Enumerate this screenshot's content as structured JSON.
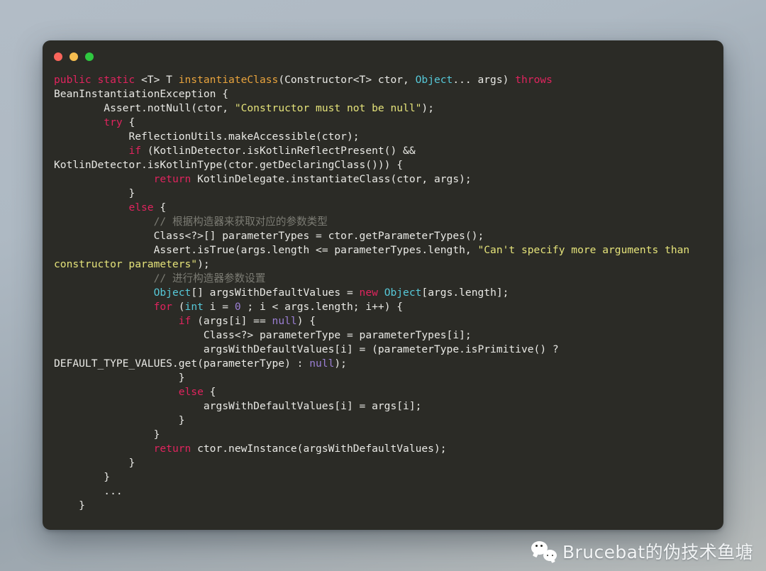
{
  "window": {
    "title": "",
    "controls": [
      {
        "name": "close",
        "color": "#f9655b"
      },
      {
        "name": "minimize",
        "color": "#f5bd4f"
      },
      {
        "name": "zoom",
        "color": "#2fc840"
      }
    ]
  },
  "theme": {
    "background_gradient_start": "#b2bcc6",
    "background_gradient_end": "#b8bcbb",
    "terminal_background": "#2b2b26",
    "plain_text": "#e9e9e5",
    "keyword": "#e0245e",
    "type": "#56c8d8",
    "function": "#e8a33d",
    "string": "#e5e37a",
    "comment": "#7c7c74",
    "number": "#9b7fd4"
  },
  "code": {
    "language": "java",
    "lines": [
      [
        {
          "t": "public static ",
          "c": "kw"
        },
        {
          "t": "<T> T ",
          "c": "pln"
        },
        {
          "t": "instantiateClass",
          "c": "fn"
        },
        {
          "t": "(Constructor<T> ctor, ",
          "c": "pln"
        },
        {
          "t": "Object",
          "c": "typ"
        },
        {
          "t": "... args) ",
          "c": "pln"
        },
        {
          "t": "throws",
          "c": "kw"
        }
      ],
      [
        {
          "t": "BeanInstantiationException {",
          "c": "pln"
        }
      ],
      [
        {
          "t": "        Assert.notNull(ctor, ",
          "c": "pln"
        },
        {
          "t": "\"Constructor must not be null\"",
          "c": "str"
        },
        {
          "t": ");",
          "c": "pln"
        }
      ],
      [
        {
          "t": "        ",
          "c": "pln"
        },
        {
          "t": "try",
          "c": "kw"
        },
        {
          "t": " {",
          "c": "pln"
        }
      ],
      [
        {
          "t": "            ReflectionUtils.makeAccessible(ctor);",
          "c": "pln"
        }
      ],
      [
        {
          "t": "            ",
          "c": "pln"
        },
        {
          "t": "if",
          "c": "kw"
        },
        {
          "t": " (KotlinDetector.isKotlinReflectPresent() &&",
          "c": "pln"
        }
      ],
      [
        {
          "t": "KotlinDetector.isKotlinType(ctor.getDeclaringClass())) {",
          "c": "pln"
        }
      ],
      [
        {
          "t": "                ",
          "c": "pln"
        },
        {
          "t": "return",
          "c": "kw"
        },
        {
          "t": " KotlinDelegate.instantiateClass(ctor, args);",
          "c": "pln"
        }
      ],
      [
        {
          "t": "            }",
          "c": "pln"
        }
      ],
      [
        {
          "t": "            ",
          "c": "pln"
        },
        {
          "t": "else",
          "c": "kw"
        },
        {
          "t": " {",
          "c": "pln"
        }
      ],
      [
        {
          "t": "                // 根据构造器来获取对应的参数类型",
          "c": "cmt"
        }
      ],
      [
        {
          "t": "                Class<?>[] parameterTypes = ctor.getParameterTypes();",
          "c": "pln"
        }
      ],
      [
        {
          "t": "                Assert.isTrue(args.length <= parameterTypes.length, ",
          "c": "pln"
        },
        {
          "t": "\"Can't specify more arguments than",
          "c": "str"
        }
      ],
      [
        {
          "t": "constructor parameters\"",
          "c": "str"
        },
        {
          "t": ");",
          "c": "pln"
        }
      ],
      [
        {
          "t": "                // 进行构造器参数设置",
          "c": "cmt"
        }
      ],
      [
        {
          "t": "                ",
          "c": "pln"
        },
        {
          "t": "Object",
          "c": "typ"
        },
        {
          "t": "[] argsWithDefaultValues = ",
          "c": "pln"
        },
        {
          "t": "new ",
          "c": "kw"
        },
        {
          "t": "Object",
          "c": "typ"
        },
        {
          "t": "[args.length];",
          "c": "pln"
        }
      ],
      [
        {
          "t": "                ",
          "c": "pln"
        },
        {
          "t": "for",
          "c": "kw"
        },
        {
          "t": " (",
          "c": "pln"
        },
        {
          "t": "int",
          "c": "typ"
        },
        {
          "t": " i = ",
          "c": "pln"
        },
        {
          "t": "0",
          "c": "num"
        },
        {
          "t": " ; i < args.length; i++) {",
          "c": "pln"
        }
      ],
      [
        {
          "t": "                    ",
          "c": "pln"
        },
        {
          "t": "if",
          "c": "kw"
        },
        {
          "t": " (args[i] == ",
          "c": "pln"
        },
        {
          "t": "null",
          "c": "num"
        },
        {
          "t": ") {",
          "c": "pln"
        }
      ],
      [
        {
          "t": "                        Class<?> parameterType = parameterTypes[i];",
          "c": "pln"
        }
      ],
      [
        {
          "t": "                        argsWithDefaultValues[i] = (parameterType.isPrimitive() ?",
          "c": "pln"
        }
      ],
      [
        {
          "t": "DEFAULT_TYPE_VALUES.get(parameterType) : ",
          "c": "pln"
        },
        {
          "t": "null",
          "c": "num"
        },
        {
          "t": ");",
          "c": "pln"
        }
      ],
      [
        {
          "t": "                    }",
          "c": "pln"
        }
      ],
      [
        {
          "t": "                    ",
          "c": "pln"
        },
        {
          "t": "else",
          "c": "kw"
        },
        {
          "t": " {",
          "c": "pln"
        }
      ],
      [
        {
          "t": "                        argsWithDefaultValues[i] = args[i];",
          "c": "pln"
        }
      ],
      [
        {
          "t": "                    }",
          "c": "pln"
        }
      ],
      [
        {
          "t": "                }",
          "c": "pln"
        }
      ],
      [
        {
          "t": "                ",
          "c": "pln"
        },
        {
          "t": "return",
          "c": "kw"
        },
        {
          "t": " ctor.newInstance(argsWithDefaultValues);",
          "c": "pln"
        }
      ],
      [
        {
          "t": "            }",
          "c": "pln"
        }
      ],
      [
        {
          "t": "        }",
          "c": "pln"
        }
      ],
      [
        {
          "t": "        ...",
          "c": "pln"
        }
      ],
      [
        {
          "t": "    }",
          "c": "pln"
        }
      ]
    ]
  },
  "watermark": {
    "icon": "wechat-icon",
    "text": "Brucebat的伪技术鱼塘"
  }
}
